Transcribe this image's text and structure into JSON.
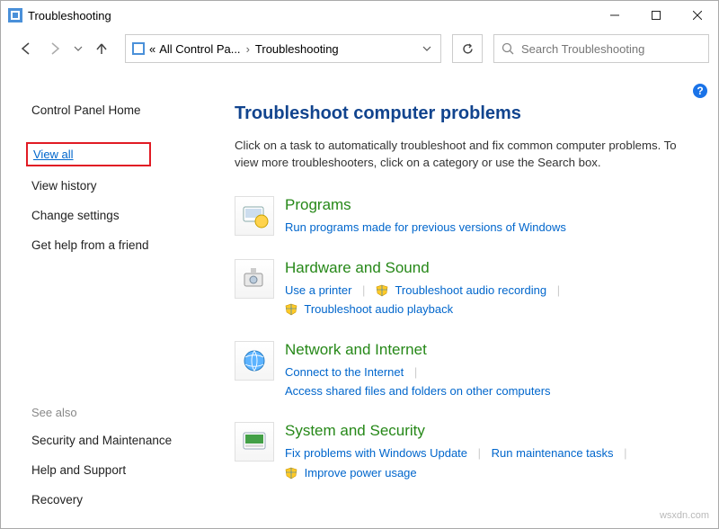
{
  "window": {
    "title": "Troubleshooting"
  },
  "breadcrumb": {
    "item1": "All Control Pa...",
    "item2": "Troubleshooting"
  },
  "search": {
    "placeholder": "Search Troubleshooting"
  },
  "sidebar": {
    "control_panel_home": "Control Panel Home",
    "view_all": "View all",
    "view_history": "View history",
    "change_settings": "Change settings",
    "get_help": "Get help from a friend",
    "see_also_label": "See also",
    "see_also": {
      "security": "Security and Maintenance",
      "help": "Help and Support",
      "recovery": "Recovery"
    }
  },
  "main": {
    "title": "Troubleshoot computer problems",
    "desc": "Click on a task to automatically troubleshoot and fix common computer problems. To view more troubleshooters, click on a category or use the Search box.",
    "cats": {
      "programs": {
        "title": "Programs",
        "l1": "Run programs made for previous versions of Windows"
      },
      "hardware": {
        "title": "Hardware and Sound",
        "l1": "Use a printer",
        "l2": "Troubleshoot audio recording",
        "l3": "Troubleshoot audio playback"
      },
      "network": {
        "title": "Network and Internet",
        "l1": "Connect to the Internet",
        "l2": "Access shared files and folders on other computers"
      },
      "system": {
        "title": "System and Security",
        "l1": "Fix problems with Windows Update",
        "l2": "Run maintenance tasks",
        "l3": "Improve power usage"
      }
    }
  },
  "watermark": "wsxdn.com"
}
